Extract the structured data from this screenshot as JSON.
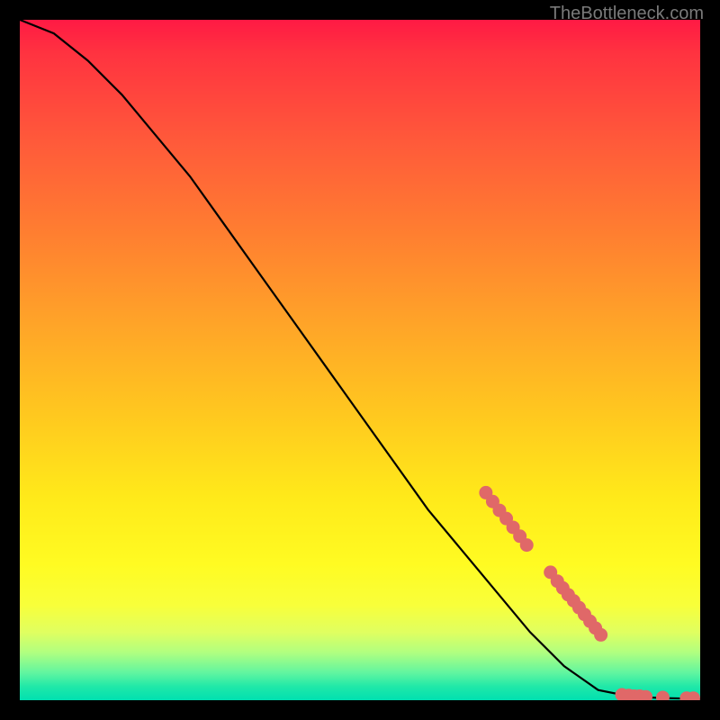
{
  "watermark": "TheBottleneck.com",
  "chart_data": {
    "type": "line",
    "title": "",
    "xlabel": "",
    "ylabel": "",
    "xlim": [
      0,
      100
    ],
    "ylim": [
      0,
      100
    ],
    "curve": {
      "name": "bottleneck-curve",
      "points": [
        {
          "x": 0,
          "y": 100
        },
        {
          "x": 5,
          "y": 98
        },
        {
          "x": 10,
          "y": 94
        },
        {
          "x": 15,
          "y": 89
        },
        {
          "x": 20,
          "y": 83
        },
        {
          "x": 25,
          "y": 77
        },
        {
          "x": 30,
          "y": 70
        },
        {
          "x": 35,
          "y": 63
        },
        {
          "x": 40,
          "y": 56
        },
        {
          "x": 45,
          "y": 49
        },
        {
          "x": 50,
          "y": 42
        },
        {
          "x": 55,
          "y": 35
        },
        {
          "x": 60,
          "y": 28
        },
        {
          "x": 65,
          "y": 22
        },
        {
          "x": 70,
          "y": 16
        },
        {
          "x": 75,
          "y": 10
        },
        {
          "x": 80,
          "y": 5
        },
        {
          "x": 85,
          "y": 1.5
        },
        {
          "x": 90,
          "y": 0.5
        },
        {
          "x": 95,
          "y": 0.3
        },
        {
          "x": 100,
          "y": 0.2
        }
      ]
    },
    "markers": {
      "name": "highlighted-points",
      "color": "#e06868",
      "points": [
        {
          "x": 68.5,
          "y": 30.5
        },
        {
          "x": 69.5,
          "y": 29.2
        },
        {
          "x": 70.5,
          "y": 27.9
        },
        {
          "x": 71.5,
          "y": 26.7
        },
        {
          "x": 72.5,
          "y": 25.4
        },
        {
          "x": 73.5,
          "y": 24.1
        },
        {
          "x": 74.5,
          "y": 22.8
        },
        {
          "x": 78.0,
          "y": 18.8
        },
        {
          "x": 79.0,
          "y": 17.5
        },
        {
          "x": 79.8,
          "y": 16.5
        },
        {
          "x": 80.6,
          "y": 15.5
        },
        {
          "x": 81.4,
          "y": 14.6
        },
        {
          "x": 82.2,
          "y": 13.6
        },
        {
          "x": 83.0,
          "y": 12.6
        },
        {
          "x": 83.8,
          "y": 11.6
        },
        {
          "x": 84.6,
          "y": 10.6
        },
        {
          "x": 85.4,
          "y": 9.6
        },
        {
          "x": 88.5,
          "y": 0.8
        },
        {
          "x": 89.5,
          "y": 0.7
        },
        {
          "x": 90.3,
          "y": 0.6
        },
        {
          "x": 91.1,
          "y": 0.6
        },
        {
          "x": 92.0,
          "y": 0.5
        },
        {
          "x": 94.5,
          "y": 0.4
        },
        {
          "x": 98.0,
          "y": 0.3
        },
        {
          "x": 99.0,
          "y": 0.3
        }
      ]
    }
  }
}
